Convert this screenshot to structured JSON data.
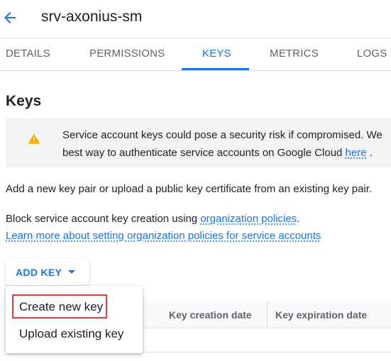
{
  "header": {
    "title": "srv-axonius-sm",
    "back_icon": "arrow-back-icon"
  },
  "tabs": [
    {
      "label": "DETAILS"
    },
    {
      "label": "PERMISSIONS"
    },
    {
      "label": "KEYS",
      "active": true
    },
    {
      "label": "METRICS"
    },
    {
      "label": "LOGS"
    }
  ],
  "section_title": "Keys",
  "banner": {
    "icon": "warning-icon",
    "line1": "Service account keys could pose a security risk if compromised. We",
    "line2_prefix": "best way to authenticate service accounts on Google Cloud ",
    "line2_link": "here",
    "line2_suffix": " ."
  },
  "description": "Add a new key pair or upload a public key certificate from an existing key pair.",
  "policy": {
    "prefix": "Block service account key creation using ",
    "link": "organization policies",
    "suffix": ".",
    "learn_more": "Learn more about setting organization policies for service accounts"
  },
  "add_key": {
    "label": "ADD KEY"
  },
  "table": {
    "columns": [
      "Key creation date",
      "Key expiration date"
    ]
  },
  "menu": {
    "items": [
      "Create new key",
      "Upload existing key"
    ]
  },
  "colors": {
    "accent": "#1a73e8",
    "warning": "#f9ab00",
    "highlight": "#e53935"
  }
}
